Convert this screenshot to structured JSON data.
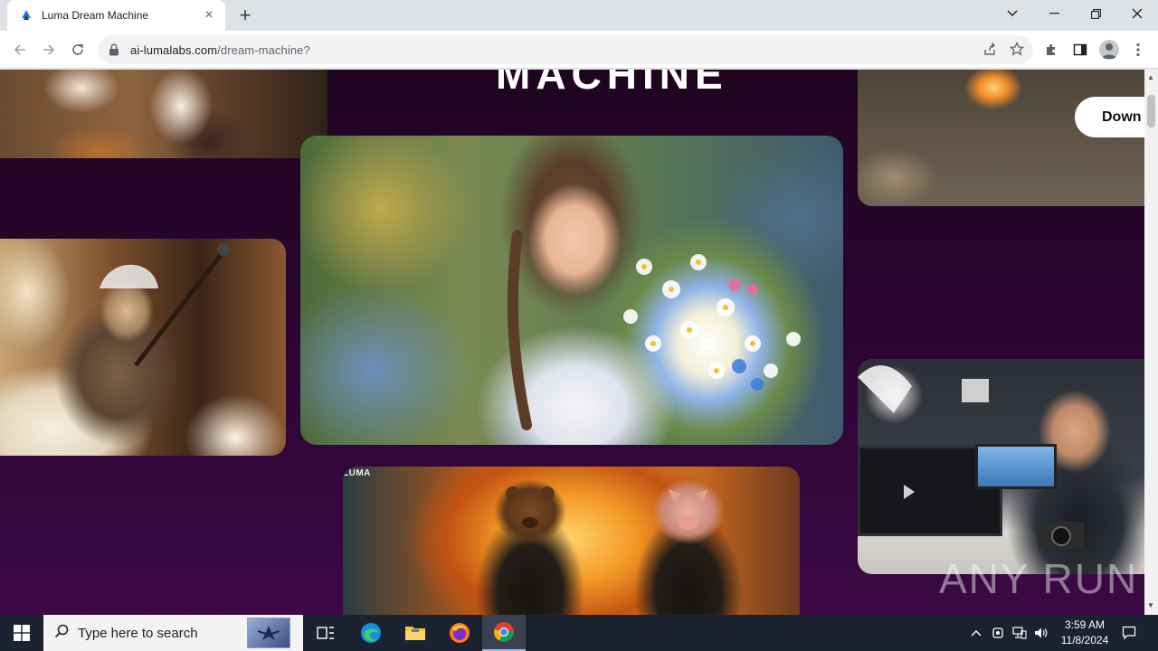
{
  "browser": {
    "tab_title": "Luma Dream Machine",
    "url_domain": "ai-lumalabs.com",
    "url_path": "/dream-machine?",
    "new_tab_label": "+",
    "tab_close_label": "×"
  },
  "page": {
    "hero_title_fragment": "MACHINE",
    "download_button": "Down",
    "luma_label": "LUMA",
    "watermark": "ANY RUN",
    "background_color": "#2a0530"
  },
  "taskbar": {
    "search_placeholder": "Type here to search",
    "time": "3:59 AM",
    "date": "11/8/2024",
    "apps": [
      "task-view",
      "edge",
      "file-explorer",
      "firefox",
      "chrome"
    ]
  },
  "colors": {
    "taskbar_bg": "#1b2330",
    "tab_strip_bg": "#dee1e6",
    "accent_active": "#9ab8f0"
  }
}
